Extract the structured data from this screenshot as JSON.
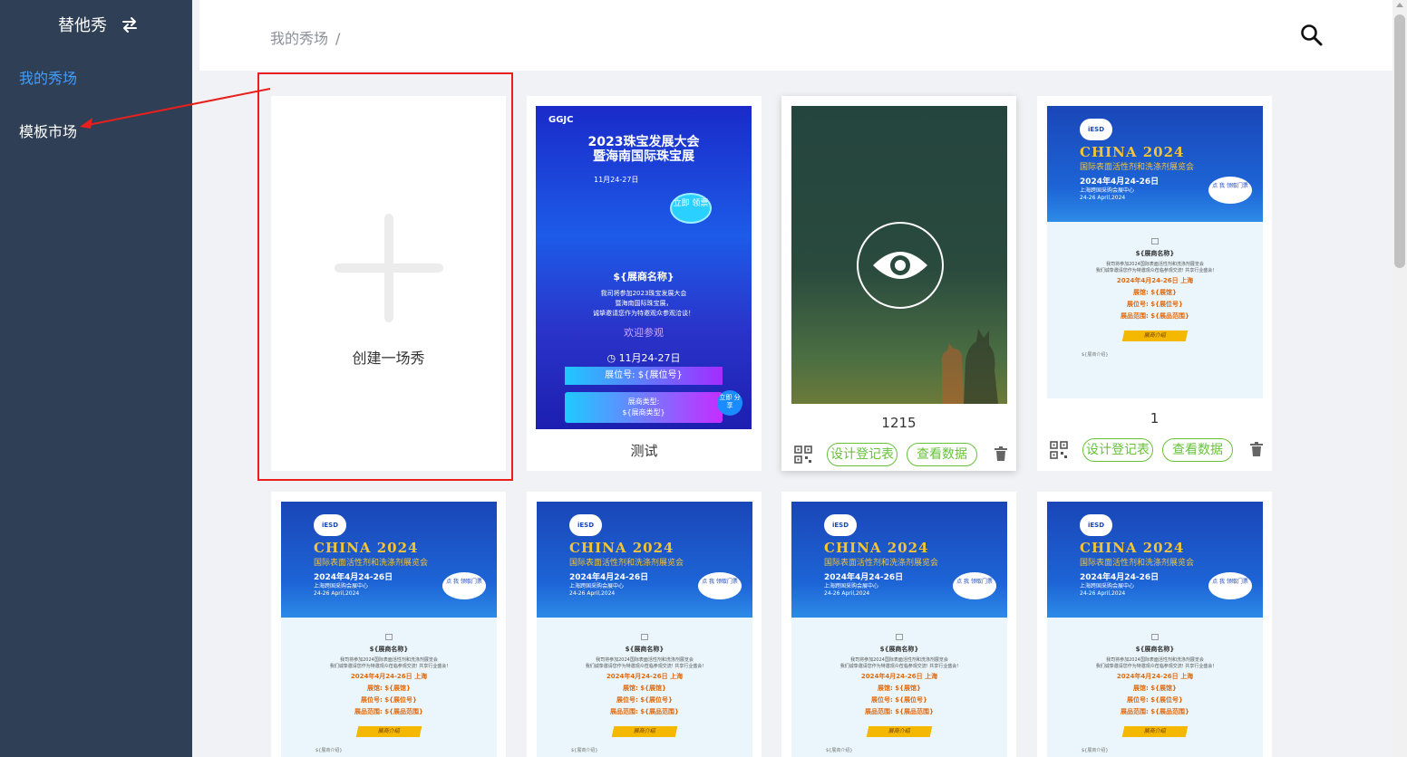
{
  "sidebar": {
    "brand": "替他秀",
    "items": [
      {
        "label": "我的秀场",
        "active": true
      },
      {
        "label": "模板市场",
        "active": false
      }
    ]
  },
  "topbar": {
    "breadcrumb": "我的秀场",
    "breadcrumb_sep": "/",
    "search_icon": "search-icon"
  },
  "create_card": {
    "label": "创建一场秀"
  },
  "shows": [
    {
      "title": "测试",
      "poster": {
        "logo": "GGJC",
        "title": "2023珠宝发展大会\n暨海南国际珠宝展",
        "date": "11月24-27日",
        "badge": "立即\n领票",
        "exhibitor": "${展商名称}",
        "text": "我司将参加2023珠宝发展大会\n暨海南国际珠宝展，\n诚挚邀请您作为特邀观众参观洽谈！",
        "welcome": "欢迎参观",
        "time": "11月24-27日",
        "booth": "展位号: ${展位号}",
        "type": "展商类型:\n${展商类型}",
        "share": "立即\n分享"
      }
    },
    {
      "title": "1215",
      "actions": {
        "design": "设计登记表",
        "data": "查看数据"
      }
    },
    {
      "title": "1",
      "actions": {
        "design": "设计登记表",
        "data": "查看数据"
      }
    }
  ],
  "china_poster": {
    "logo": "iESD",
    "title": "CHINA 2024",
    "subtitle": "国际表面活性剂和洗涤剂展览会",
    "date": "2024年4月24-26日",
    "venue": "上海跨国采购会展中心\n24-26 April,2024",
    "badge": "点 我\n领取门票",
    "exhibitor": "${展商名称}",
    "text": "我司将参加2024国际表面活性剂和洗涤剂展览会\n我们诚挚邀请您作为特邀观众莅临参观交流! 共享行业盛会!",
    "line1": "2024年4月24-26日 上海",
    "line2": "展馆: ${展馆}",
    "line3": "展位号: ${展位号}",
    "line4": "展品范围: ${展品范围}",
    "button": "展商介绍",
    "intro": "${展商介绍}"
  },
  "colors": {
    "sidebar_bg": "#2f3f55",
    "active": "#409eff",
    "action_green": "#67c23a",
    "annotation_red": "#e8201c"
  }
}
